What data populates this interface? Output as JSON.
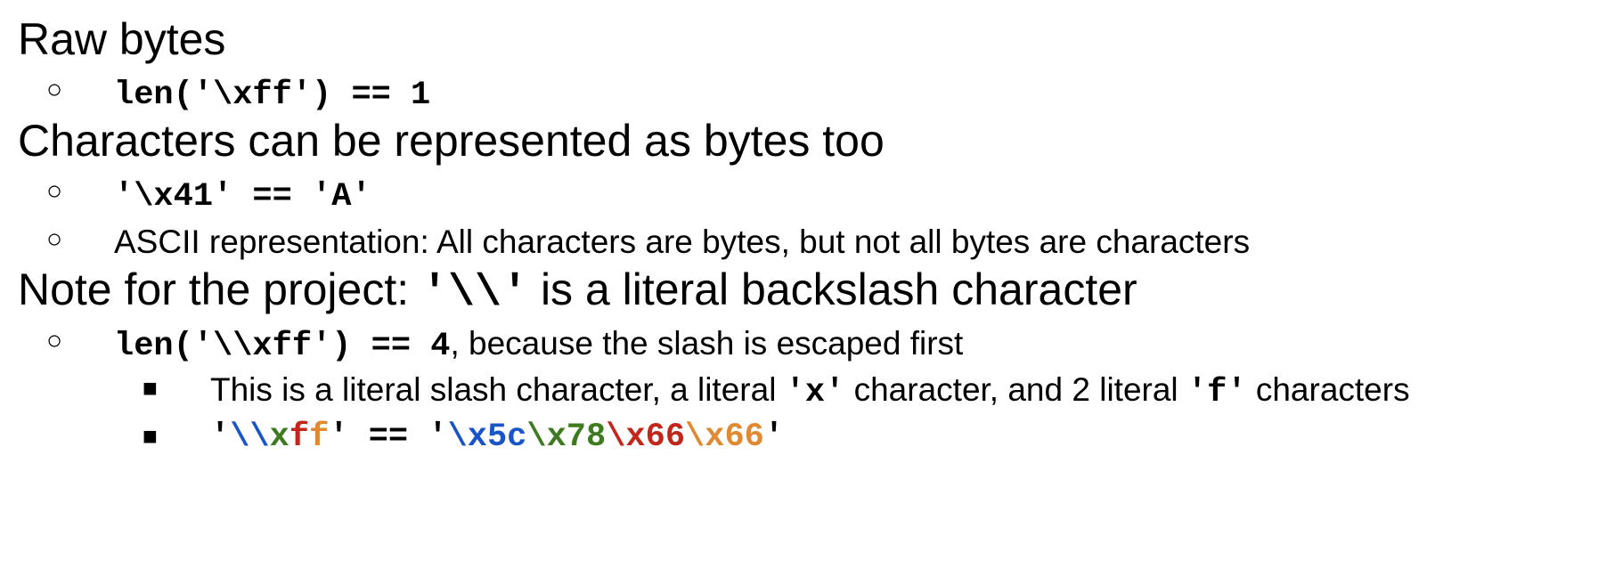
{
  "bullets": {
    "hollow": "○",
    "square": "■"
  },
  "colors": {
    "blue": "#1a55c8",
    "green": "#3e7a1f",
    "orange": "#df8a33",
    "red": "#c1271b"
  },
  "items": [
    {
      "heading": "Raw bytes",
      "sub": [
        {
          "code": "len('\\xff') == 1"
        }
      ]
    },
    {
      "heading": "Characters can be represented as bytes too",
      "sub": [
        {
          "code": "'\\x41' == 'A'"
        },
        {
          "text": "ASCII representation: All characters are bytes, but not all bytes are characters"
        }
      ]
    },
    {
      "heading_prefix": "Note for the project: ",
      "heading_code": "'\\\\'",
      "heading_suffix": " is a literal backslash character",
      "sub": [
        {
          "code": "len('\\\\xff') == 4",
          "text": ", because the slash is escaped first",
          "sub": [
            {
              "text_a": "This is a literal slash character, a literal ",
              "code_a": "'x'",
              "text_b": " character, and 2 literal ",
              "code_b": "'f'",
              "text_c": " characters"
            },
            {
              "q1": "'",
              "bs1": "\\\\",
              "x1": "x",
              "f1": "f",
              "f2": "f",
              "q2": "'",
              "eq": " == ",
              "q3": "'",
              "h1": "\\x5c",
              "h2": "\\x78",
              "h3": "\\x66",
              "h4": "\\x66",
              "q4": "'"
            }
          ]
        }
      ]
    }
  ]
}
